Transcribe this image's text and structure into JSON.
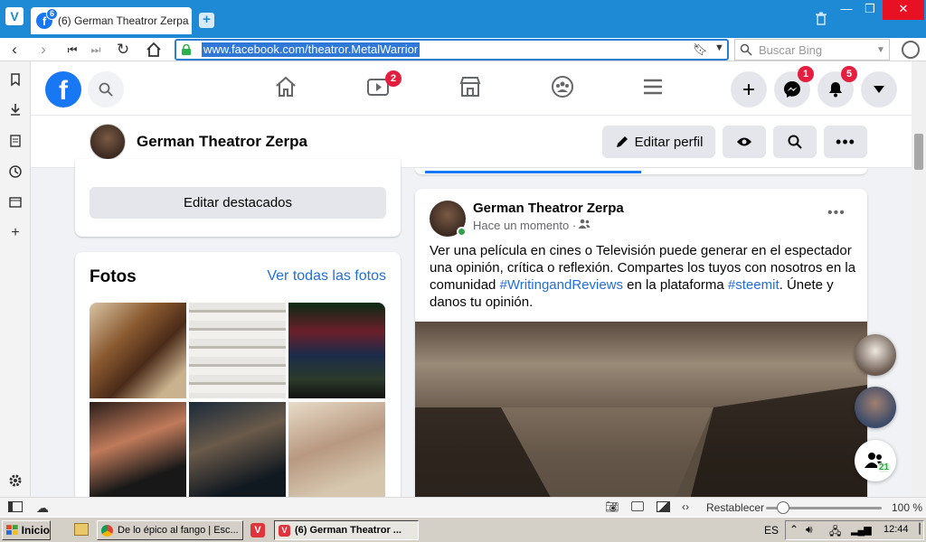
{
  "browser": {
    "tab_title": "(6) German Theatror Zerpa",
    "tab_badge": "6",
    "url": "www.facebook.com/theatror.MetalWarrior",
    "search_placeholder": "Buscar Bing",
    "window_controls": [
      "—",
      "❐",
      "✕"
    ]
  },
  "fb": {
    "nav_badges": {
      "watch": "2",
      "messenger": "1",
      "notifications": "5"
    },
    "profile_name": "German Theatror Zerpa",
    "edit_profile_label": "Editar perfil",
    "edit_highlights_label": "Editar destacados",
    "photos_title": "Fotos",
    "photos_link": "Ver todas las fotos",
    "post": {
      "author": "German Theatror Zerpa",
      "time": "Hace un momento ·",
      "text_1": "Ver una película en cines o Televisión  puede generar en el espectador una opinión, crítica o reflexión. Compartes los tuyos con nosotros en la comunidad ",
      "hashtag_1": "#WritingandReviews",
      "text_2": " en la plataforma ",
      "hashtag_2": "#steemit",
      "text_3": ". Únete y danos tu opinión."
    },
    "online_count": "21"
  },
  "statusbar": {
    "reset_label": "Restablecer",
    "zoom": "100 %",
    "zoom_level": 0.15
  },
  "taskbar": {
    "start_label": "Inicio",
    "items": [
      "De lo épico al fango | Esc...",
      "(6) German Theatror ..."
    ],
    "lang": "ES",
    "clock": "12:44"
  },
  "colors": {
    "fb_blue": "#1877f2",
    "browser_blue": "#1e8ad6",
    "badge_red": "#e41e3f"
  }
}
